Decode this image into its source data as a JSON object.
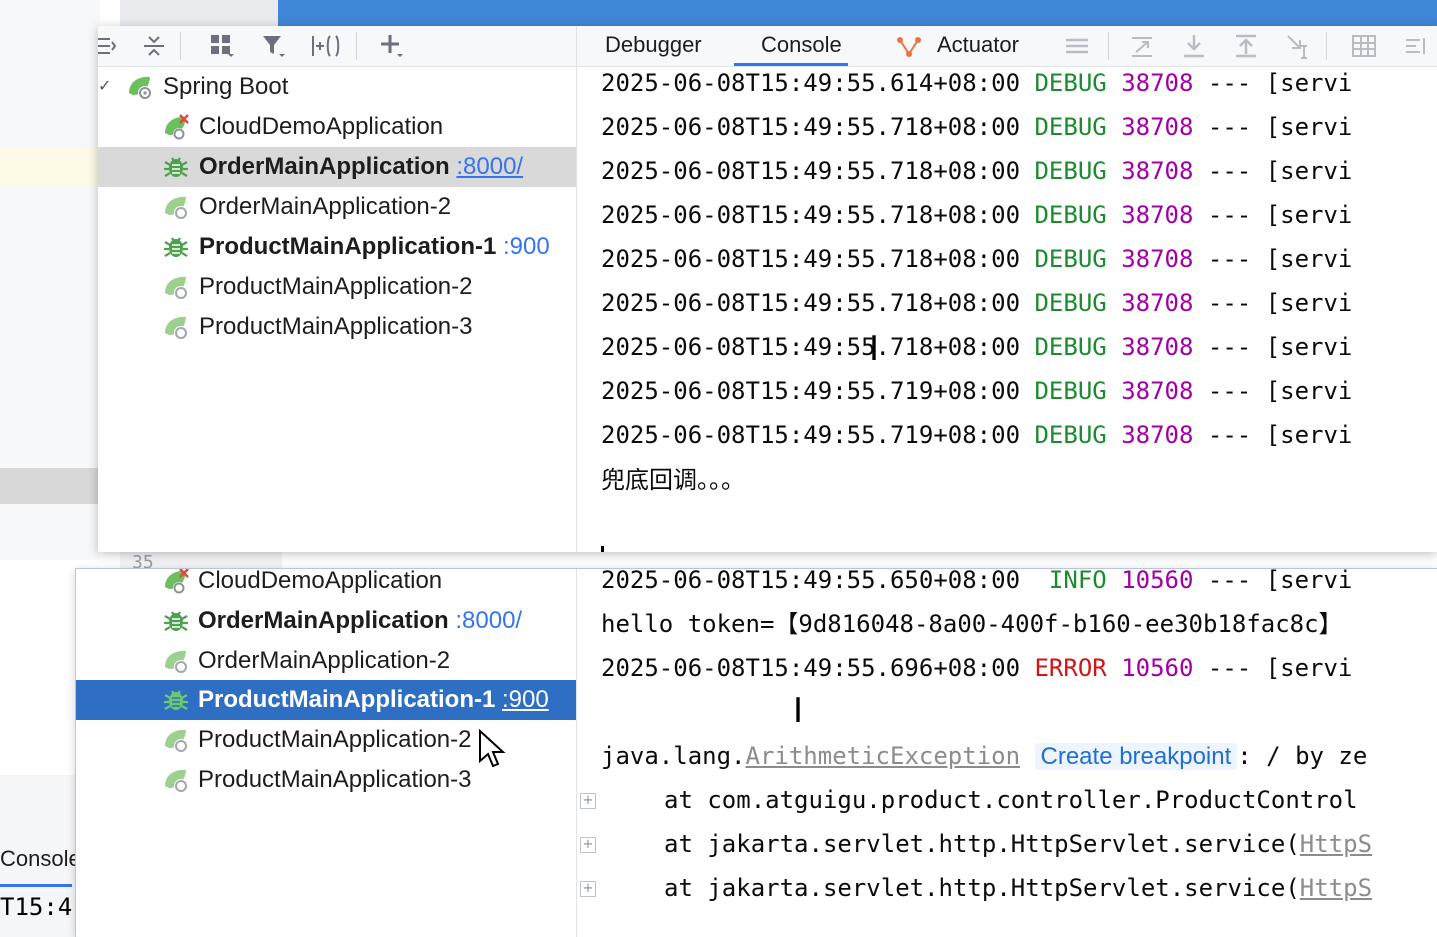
{
  "background": {
    "gutter_line_number": "35",
    "console_tab_label": "Console",
    "console_text": "T15:4"
  },
  "toolbar": {
    "icons": [
      "expand-all-icon",
      "collapse-all-icon",
      "group-icon",
      "filter-icon",
      "add-config-icon",
      "add-icon"
    ],
    "tabs": [
      {
        "label": "Debugger",
        "active": false
      },
      {
        "label": "Console",
        "active": true
      },
      {
        "label": "Actuator",
        "active": false
      }
    ],
    "accent_color": "#3574f0"
  },
  "window1": {
    "tree": {
      "root_label": "Spring Boot",
      "items": [
        {
          "label": "CloudDemoApplication",
          "port": "",
          "bold": false,
          "state": "error"
        },
        {
          "label": "OrderMainApplication",
          "port": ":8000/",
          "bold": true,
          "state": "debug",
          "selected": "gray"
        },
        {
          "label": "OrderMainApplication-2",
          "port": "",
          "bold": false,
          "state": "stopped"
        },
        {
          "label": "ProductMainApplication-1",
          "port": ":900",
          "bold": true,
          "state": "debug"
        },
        {
          "label": "ProductMainApplication-2",
          "port": "",
          "bold": false,
          "state": "stopped"
        },
        {
          "label": "ProductMainApplication-3",
          "port": "",
          "bold": false,
          "state": "stopped"
        }
      ]
    },
    "console": {
      "lines": [
        {
          "ts": "2025-06-08T15:49:55.614+08:00",
          "level": "DEBUG",
          "pid": "38708",
          "rest": "--- [servi"
        },
        {
          "ts": "2025-06-08T15:49:55.718+08:00",
          "level": "DEBUG",
          "pid": "38708",
          "rest": "--- [servi"
        },
        {
          "ts": "2025-06-08T15:49:55.718+08:00",
          "level": "DEBUG",
          "pid": "38708",
          "rest": "--- [servi"
        },
        {
          "ts": "2025-06-08T15:49:55.718+08:00",
          "level": "DEBUG",
          "pid": "38708",
          "rest": "--- [servi"
        },
        {
          "ts": "2025-06-08T15:49:55.718+08:00",
          "level": "DEBUG",
          "pid": "38708",
          "rest": "--- [servi"
        },
        {
          "ts": "2025-06-08T15:49:55.718+08:00",
          "level": "DEBUG",
          "pid": "38708",
          "rest": "--- [servi"
        },
        {
          "ts": "2025-06-08T15:49:55.718+08:00",
          "level": "DEBUG",
          "pid": "38708",
          "rest": "--- [servi"
        },
        {
          "ts": "2025-06-08T15:49:55.719+08:00",
          "level": "DEBUG",
          "pid": "38708",
          "rest": "--- [servi"
        },
        {
          "ts": "2025-06-08T15:49:55.719+08:00",
          "level": "DEBUG",
          "pid": "38708",
          "rest": "--- [servi"
        }
      ],
      "fallback_message": "兜底回调。。。"
    }
  },
  "window2": {
    "tree": {
      "items": [
        {
          "label": "CloudDemoApplication",
          "port": "",
          "bold": false,
          "state": "error"
        },
        {
          "label": "OrderMainApplication",
          "port": ":8000/",
          "bold": true,
          "state": "debug"
        },
        {
          "label": "OrderMainApplication-2",
          "port": "",
          "bold": false,
          "state": "stopped"
        },
        {
          "label": "ProductMainApplication-1",
          "port": ":900",
          "bold": true,
          "state": "debug",
          "selected": "blue"
        },
        {
          "label": "ProductMainApplication-2",
          "port": "",
          "bold": false,
          "state": "stopped"
        },
        {
          "label": "ProductMainApplication-3",
          "port": "",
          "bold": false,
          "state": "stopped"
        }
      ]
    },
    "console": {
      "info_line": {
        "ts": "2025-06-08T15:49:55.650+08:00",
        "level": " INFO",
        "pid": "10560",
        "rest": "--- [servi"
      },
      "token_line": "hello token=【9d816048-8a00-400f-b160-ee30b18fac8c】",
      "error_line": {
        "ts": "2025-06-08T15:49:55.696+08:00",
        "level": "ERROR",
        "pid": "10560",
        "rest": "--- [servi"
      },
      "exception": {
        "prefix": "java.lang.",
        "class": "ArithmeticException",
        "breakpoint_label": "Create breakpoint",
        "suffix": ": / by ze"
      },
      "stack": [
        {
          "text": "at com.atguigu.product.controller.ProductControl",
          "link": ""
        },
        {
          "text": "at jakarta.servlet.http.HttpServlet.service(",
          "link": "HttpS"
        },
        {
          "text": "at jakarta.servlet.http.HttpServlet.service(",
          "link": "HttpS"
        }
      ]
    }
  }
}
